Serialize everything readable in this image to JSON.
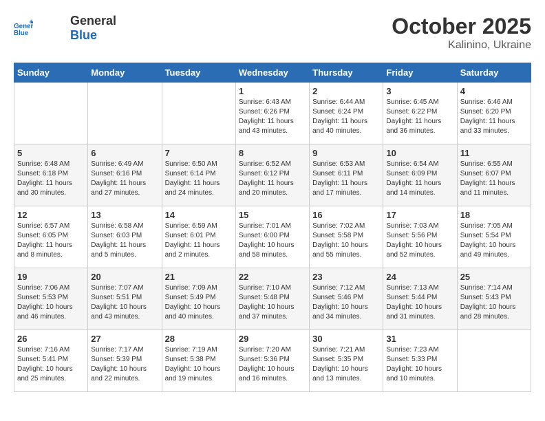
{
  "header": {
    "logo_line1": "General",
    "logo_line2": "Blue",
    "title": "October 2025",
    "subtitle": "Kalinino, Ukraine"
  },
  "days_of_week": [
    "Sunday",
    "Monday",
    "Tuesday",
    "Wednesday",
    "Thursday",
    "Friday",
    "Saturday"
  ],
  "weeks": [
    [
      {
        "day": "",
        "content": ""
      },
      {
        "day": "",
        "content": ""
      },
      {
        "day": "",
        "content": ""
      },
      {
        "day": "1",
        "content": "Sunrise: 6:43 AM\nSunset: 6:26 PM\nDaylight: 11 hours\nand 43 minutes."
      },
      {
        "day": "2",
        "content": "Sunrise: 6:44 AM\nSunset: 6:24 PM\nDaylight: 11 hours\nand 40 minutes."
      },
      {
        "day": "3",
        "content": "Sunrise: 6:45 AM\nSunset: 6:22 PM\nDaylight: 11 hours\nand 36 minutes."
      },
      {
        "day": "4",
        "content": "Sunrise: 6:46 AM\nSunset: 6:20 PM\nDaylight: 11 hours\nand 33 minutes."
      }
    ],
    [
      {
        "day": "5",
        "content": "Sunrise: 6:48 AM\nSunset: 6:18 PM\nDaylight: 11 hours\nand 30 minutes."
      },
      {
        "day": "6",
        "content": "Sunrise: 6:49 AM\nSunset: 6:16 PM\nDaylight: 11 hours\nand 27 minutes."
      },
      {
        "day": "7",
        "content": "Sunrise: 6:50 AM\nSunset: 6:14 PM\nDaylight: 11 hours\nand 24 minutes."
      },
      {
        "day": "8",
        "content": "Sunrise: 6:52 AM\nSunset: 6:12 PM\nDaylight: 11 hours\nand 20 minutes."
      },
      {
        "day": "9",
        "content": "Sunrise: 6:53 AM\nSunset: 6:11 PM\nDaylight: 11 hours\nand 17 minutes."
      },
      {
        "day": "10",
        "content": "Sunrise: 6:54 AM\nSunset: 6:09 PM\nDaylight: 11 hours\nand 14 minutes."
      },
      {
        "day": "11",
        "content": "Sunrise: 6:55 AM\nSunset: 6:07 PM\nDaylight: 11 hours\nand 11 minutes."
      }
    ],
    [
      {
        "day": "12",
        "content": "Sunrise: 6:57 AM\nSunset: 6:05 PM\nDaylight: 11 hours\nand 8 minutes."
      },
      {
        "day": "13",
        "content": "Sunrise: 6:58 AM\nSunset: 6:03 PM\nDaylight: 11 hours\nand 5 minutes."
      },
      {
        "day": "14",
        "content": "Sunrise: 6:59 AM\nSunset: 6:01 PM\nDaylight: 11 hours\nand 2 minutes."
      },
      {
        "day": "15",
        "content": "Sunrise: 7:01 AM\nSunset: 6:00 PM\nDaylight: 10 hours\nand 58 minutes."
      },
      {
        "day": "16",
        "content": "Sunrise: 7:02 AM\nSunset: 5:58 PM\nDaylight: 10 hours\nand 55 minutes."
      },
      {
        "day": "17",
        "content": "Sunrise: 7:03 AM\nSunset: 5:56 PM\nDaylight: 10 hours\nand 52 minutes."
      },
      {
        "day": "18",
        "content": "Sunrise: 7:05 AM\nSunset: 5:54 PM\nDaylight: 10 hours\nand 49 minutes."
      }
    ],
    [
      {
        "day": "19",
        "content": "Sunrise: 7:06 AM\nSunset: 5:53 PM\nDaylight: 10 hours\nand 46 minutes."
      },
      {
        "day": "20",
        "content": "Sunrise: 7:07 AM\nSunset: 5:51 PM\nDaylight: 10 hours\nand 43 minutes."
      },
      {
        "day": "21",
        "content": "Sunrise: 7:09 AM\nSunset: 5:49 PM\nDaylight: 10 hours\nand 40 minutes."
      },
      {
        "day": "22",
        "content": "Sunrise: 7:10 AM\nSunset: 5:48 PM\nDaylight: 10 hours\nand 37 minutes."
      },
      {
        "day": "23",
        "content": "Sunrise: 7:12 AM\nSunset: 5:46 PM\nDaylight: 10 hours\nand 34 minutes."
      },
      {
        "day": "24",
        "content": "Sunrise: 7:13 AM\nSunset: 5:44 PM\nDaylight: 10 hours\nand 31 minutes."
      },
      {
        "day": "25",
        "content": "Sunrise: 7:14 AM\nSunset: 5:43 PM\nDaylight: 10 hours\nand 28 minutes."
      }
    ],
    [
      {
        "day": "26",
        "content": "Sunrise: 7:16 AM\nSunset: 5:41 PM\nDaylight: 10 hours\nand 25 minutes."
      },
      {
        "day": "27",
        "content": "Sunrise: 7:17 AM\nSunset: 5:39 PM\nDaylight: 10 hours\nand 22 minutes."
      },
      {
        "day": "28",
        "content": "Sunrise: 7:19 AM\nSunset: 5:38 PM\nDaylight: 10 hours\nand 19 minutes."
      },
      {
        "day": "29",
        "content": "Sunrise: 7:20 AM\nSunset: 5:36 PM\nDaylight: 10 hours\nand 16 minutes."
      },
      {
        "day": "30",
        "content": "Sunrise: 7:21 AM\nSunset: 5:35 PM\nDaylight: 10 hours\nand 13 minutes."
      },
      {
        "day": "31",
        "content": "Sunrise: 7:23 AM\nSunset: 5:33 PM\nDaylight: 10 hours\nand 10 minutes."
      },
      {
        "day": "",
        "content": ""
      }
    ]
  ]
}
